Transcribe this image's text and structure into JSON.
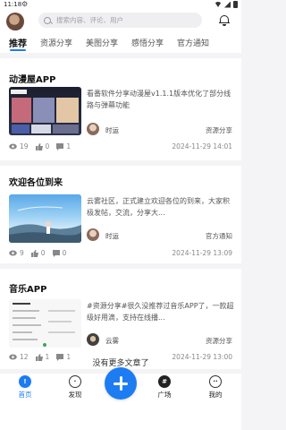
{
  "status_bar": {
    "time": "11:18"
  },
  "header": {
    "search_placeholder": "搜索内容、评论、用户"
  },
  "tabs": [
    {
      "label": "推荐",
      "active": true
    },
    {
      "label": "资源分享"
    },
    {
      "label": "美图分享"
    },
    {
      "label": "感悟分享"
    },
    {
      "label": "官方通知"
    }
  ],
  "posts": [
    {
      "title": "动漫屋APP",
      "excerpt": "看番软件分享动漫屋v1.1.1版本优化了部分线路与弹幕功能",
      "author": "时运",
      "category": "资源分享",
      "views": "19",
      "likes": "0",
      "comments": "1",
      "time": "2024-11-29 14:01"
    },
    {
      "title": "欢迎各位到来",
      "excerpt": "云雾社区，正式建立欢迎各位的到来，大家积极发帖，交流，分享大...",
      "author": "时运",
      "category": "官方通知",
      "views": "9",
      "likes": "0",
      "comments": "0",
      "time": "2024-11-29 13:09"
    },
    {
      "title": "音乐APP",
      "excerpt": "#资源分享#很久没推荐过音乐APP了，一款超级好用滴，支持在线播...",
      "author": "云雾",
      "category": "资源分享",
      "views": "12",
      "likes": "1",
      "comments": "1",
      "time": "2024-11-29 13:00"
    }
  ],
  "footer_text": "没有更多文章了",
  "bottom_nav": {
    "home": "首页",
    "discover": "发现",
    "square": "广场",
    "mine": "我的"
  },
  "colors": {
    "accent": "#1e7cf2"
  }
}
